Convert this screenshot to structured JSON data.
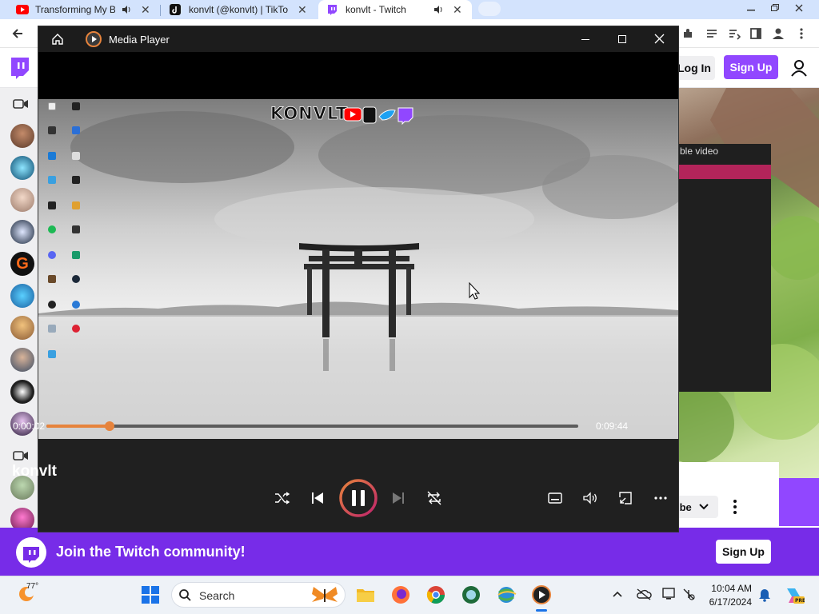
{
  "browser": {
    "tabs": [
      {
        "title": "Transforming My B",
        "favicon": "youtube-icon",
        "audio": true
      },
      {
        "title": "konvlt (@konvlt) | TikTo",
        "favicon": "tiktok-icon",
        "audio": false
      },
      {
        "title": "konvlt - Twitch",
        "favicon": "twitch-icon",
        "audio": true,
        "active": true
      }
    ]
  },
  "twitch": {
    "login_label": "Log In",
    "signup_label": "Sign Up",
    "subscribe_fragment": "ibe",
    "join_text": "Join the Twitch community!",
    "join_signup_label": "Sign Up",
    "accent": "#9147ff",
    "banner_color": "#772ce8"
  },
  "media_player": {
    "app_title": "Media Player",
    "track_title": "konvlt",
    "current_time": "0:00:02",
    "total_time": "0:09:44",
    "progress": 0.0034,
    "accent": "#e6833c",
    "overlay_logo_text": "KONVLT"
  },
  "taskbar": {
    "weather_temp": "77°",
    "search_placeholder": "Search",
    "clock_time": "10:04 AM",
    "clock_date": "6/17/2024"
  }
}
